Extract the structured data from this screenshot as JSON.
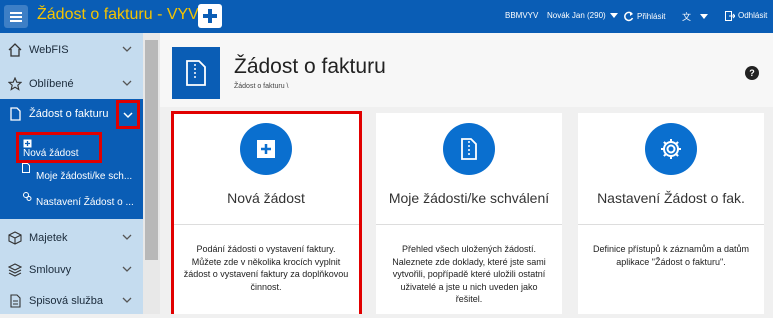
{
  "topbar": {
    "title": "Žádost o fakturu - VYV",
    "db": "BBMVYV",
    "user": "Novák Jan (290)",
    "login_label": "Přihlásit",
    "logout_label": "Odhlásit"
  },
  "sidebar": {
    "items": [
      {
        "label": "WebFIS"
      },
      {
        "label": "Oblíbené"
      },
      {
        "label": "Žádost o fakturu"
      },
      {
        "label": "Majetek"
      },
      {
        "label": "Smlouvy"
      },
      {
        "label": "Spisová služba"
      }
    ],
    "sub_items": [
      {
        "label": "Nová žádost"
      },
      {
        "label": "Moje žádosti/ke sch..."
      },
      {
        "label": "Nastavení Žádost o ..."
      }
    ]
  },
  "header": {
    "title": "Žádost o fakturu",
    "breadcrumb": "Žádost o fakturu \\",
    "help": "?"
  },
  "tiles": [
    {
      "title": "Nová žádost",
      "desc": "Podání žádosti o vystavení faktury. Můžete zde v několika krocích vyplnit žádost o vystavení faktury za doplňkovou činnost."
    },
    {
      "title": "Moje žádosti/ke schválení",
      "desc": "Přehled všech uložených žádostí. Naleznete zde doklady, které jste sami vytvořili, popřípadě které uložili ostatní uživatelé a jste u nich uveden jako řešitel."
    },
    {
      "title": "Nastavení Žádost o fak.",
      "desc": "Definice přístupů k záznamům a datům aplikace \"Žádost o fakturu\"."
    }
  ],
  "colors": {
    "brand": "#0a5db5",
    "title_accent": "#f5c400",
    "highlight": "#e10000"
  }
}
